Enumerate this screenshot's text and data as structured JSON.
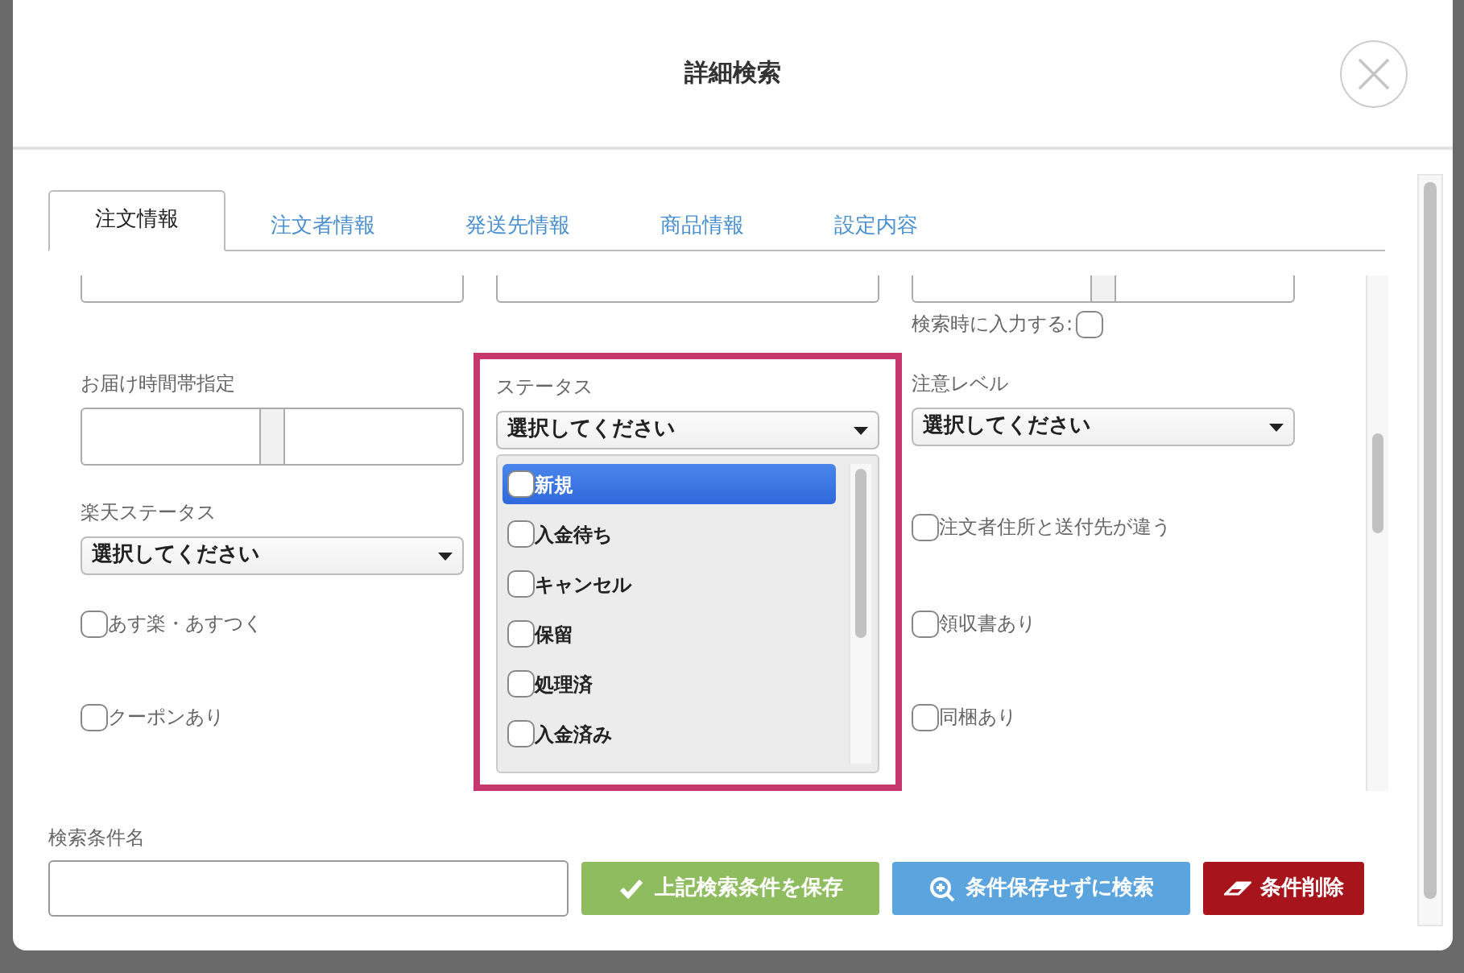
{
  "dialog": {
    "title": "詳細検索"
  },
  "tabs": [
    {
      "label": "注文情報",
      "selected": true
    },
    {
      "label": "注文者情報",
      "selected": false
    },
    {
      "label": "発送先情報",
      "selected": false
    },
    {
      "label": "商品情報",
      "selected": false
    },
    {
      "label": "設定内容",
      "selected": false
    }
  ],
  "form_rows": [
    {
      "cells": [
        {
          "kind": "text"
        },
        {
          "kind": "text"
        },
        {
          "kind": "range",
          "note": "検索時に入力する:",
          "checked": false
        }
      ]
    },
    {
      "cells": [
        {
          "kind": "range",
          "label": "お届け時間帯指定"
        },
        {
          "kind": "status_list",
          "label": "ステータス",
          "value": "選択してください",
          "highlighted": true,
          "options": [
            {
              "label": "新規",
              "checked": false,
              "selected": true
            },
            {
              "label": "入金待ち",
              "checked": false,
              "selected": false
            },
            {
              "label": "キャンセル",
              "checked": false,
              "selected": false
            },
            {
              "label": "保留",
              "checked": false,
              "selected": false
            },
            {
              "label": "処理済",
              "checked": false,
              "selected": false
            },
            {
              "label": "入金済み",
              "checked": false,
              "selected": false
            }
          ]
        },
        {
          "kind": "select",
          "label": "注意レベル",
          "value": "選択してください"
        }
      ]
    },
    {
      "cells": [
        {
          "kind": "select",
          "label": "楽天ステータス",
          "value": "選択してください"
        },
        {
          "kind": "checkbox",
          "label": "注文者住所と送付先が違う",
          "checked": false
        }
      ]
    },
    {
      "cells": [
        {
          "kind": "checkbox",
          "label": "あす楽・あすつく",
          "checked": false
        },
        {
          "kind": "checkbox",
          "label": "領収書あり",
          "checked": false
        }
      ]
    },
    {
      "cells": [
        {
          "kind": "checkbox",
          "label": "クーポンあり",
          "checked": false
        },
        {
          "kind": "checkbox",
          "label": "同梱あり",
          "checked": false
        }
      ]
    }
  ],
  "footer": {
    "name_label": "検索条件名",
    "buttons": [
      {
        "kind": "save",
        "label": "上記検索条件を保存"
      },
      {
        "kind": "search",
        "label": "条件保存せずに検索"
      },
      {
        "kind": "delete",
        "label": "条件削除"
      }
    ]
  }
}
